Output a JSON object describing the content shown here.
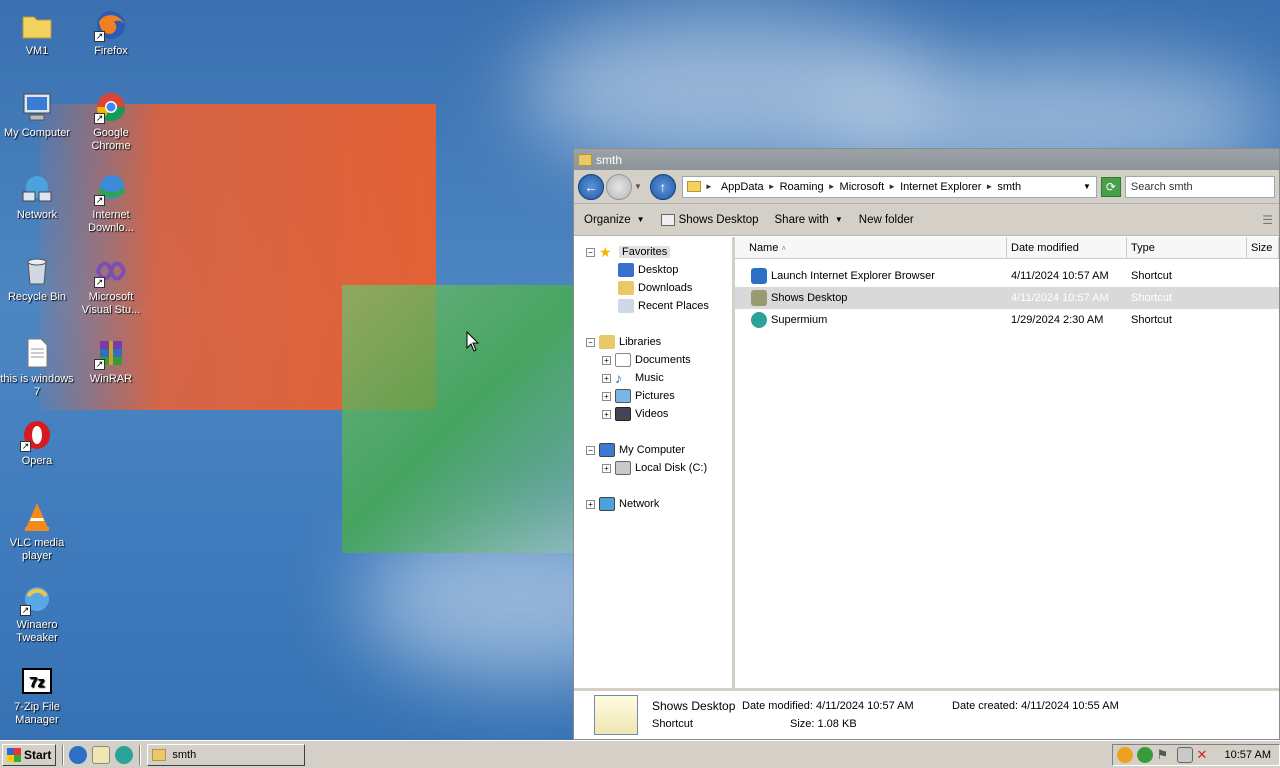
{
  "desktop": {
    "icons": [
      {
        "label": "VM1",
        "icon": "folder-icon"
      },
      {
        "label": "Firefox",
        "icon": "firefox-icon"
      },
      {
        "label": "My Computer",
        "icon": "computer-icon"
      },
      {
        "label": "Google Chrome",
        "icon": "chrome-icon"
      },
      {
        "label": "Network",
        "icon": "network-icon"
      },
      {
        "label": "Internet Downlo...",
        "icon": "idm-icon"
      },
      {
        "label": "Recycle Bin",
        "icon": "recycle-bin-icon"
      },
      {
        "label": "Microsoft Visual Stu...",
        "icon": "visual-studio-icon"
      },
      {
        "label": "this is windows 7",
        "icon": "text-file-icon"
      },
      {
        "label": "WinRAR",
        "icon": "winrar-icon"
      },
      {
        "label": "Opera",
        "icon": "opera-icon"
      },
      {
        "label": "VLC media player",
        "icon": "vlc-icon"
      },
      {
        "label": "Winaero Tweaker",
        "icon": "winaero-icon"
      },
      {
        "label": "7-Zip File Manager",
        "icon": "7zip-icon"
      }
    ]
  },
  "window": {
    "title": "smth",
    "address": [
      "AppData",
      "Roaming",
      "Microsoft",
      "Internet Explorer",
      "smth"
    ],
    "search_placeholder": "Search smth",
    "toolbar": {
      "organize": "Organize",
      "shows_desktop": "Shows Desktop",
      "share_with": "Share with",
      "new_folder": "New folder"
    },
    "nav": {
      "favorites": "Favorites",
      "desktop": "Desktop",
      "downloads": "Downloads",
      "recent": "Recent Places",
      "libraries": "Libraries",
      "documents": "Documents",
      "music": "Music",
      "pictures": "Pictures",
      "videos": "Videos",
      "my_computer": "My Computer",
      "local_disk": "Local Disk (C:)",
      "network": "Network"
    },
    "columns": {
      "name": "Name",
      "date": "Date modified",
      "type": "Type",
      "size": "Size"
    },
    "files": [
      {
        "name": "Launch Internet Explorer Browser",
        "date": "4/11/2024 10:57 AM",
        "type": "Shortcut",
        "icon": "ie-icon",
        "color": "#2c6fc7"
      },
      {
        "name": "Shows Desktop",
        "date": "4/11/2024 10:57 AM",
        "type": "Shortcut",
        "icon": "shows-desktop-icon",
        "color": "#9a9a70"
      },
      {
        "name": "Supermium",
        "date": "1/29/2024 2:30 AM",
        "type": "Shortcut",
        "icon": "supermium-icon",
        "color": "#2aa39a"
      }
    ],
    "details": {
      "name": "Shows Desktop",
      "type": "Shortcut",
      "date_modified": "Date modified: 4/11/2024 10:57 AM",
      "size": "Size: 1.08 KB",
      "date_created": "Date created: 4/11/2024 10:55 AM"
    }
  },
  "taskbar": {
    "start": "Start",
    "task": "smth",
    "clock": "10:57 AM"
  }
}
